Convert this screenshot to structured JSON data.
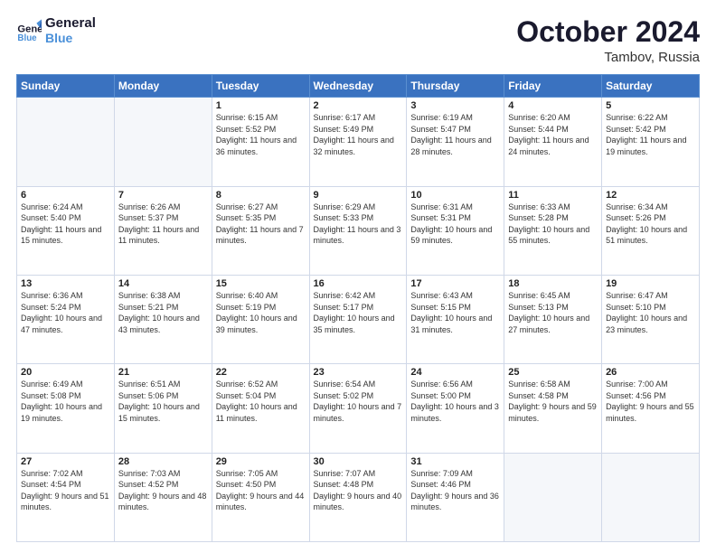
{
  "header": {
    "logo_line1": "General",
    "logo_line2": "Blue",
    "month": "October 2024",
    "location": "Tambov, Russia"
  },
  "weekdays": [
    "Sunday",
    "Monday",
    "Tuesday",
    "Wednesday",
    "Thursday",
    "Friday",
    "Saturday"
  ],
  "weeks": [
    [
      {
        "num": "",
        "info": ""
      },
      {
        "num": "",
        "info": ""
      },
      {
        "num": "1",
        "info": "Sunrise: 6:15 AM\nSunset: 5:52 PM\nDaylight: 11 hours and 36 minutes."
      },
      {
        "num": "2",
        "info": "Sunrise: 6:17 AM\nSunset: 5:49 PM\nDaylight: 11 hours and 32 minutes."
      },
      {
        "num": "3",
        "info": "Sunrise: 6:19 AM\nSunset: 5:47 PM\nDaylight: 11 hours and 28 minutes."
      },
      {
        "num": "4",
        "info": "Sunrise: 6:20 AM\nSunset: 5:44 PM\nDaylight: 11 hours and 24 minutes."
      },
      {
        "num": "5",
        "info": "Sunrise: 6:22 AM\nSunset: 5:42 PM\nDaylight: 11 hours and 19 minutes."
      }
    ],
    [
      {
        "num": "6",
        "info": "Sunrise: 6:24 AM\nSunset: 5:40 PM\nDaylight: 11 hours and 15 minutes."
      },
      {
        "num": "7",
        "info": "Sunrise: 6:26 AM\nSunset: 5:37 PM\nDaylight: 11 hours and 11 minutes."
      },
      {
        "num": "8",
        "info": "Sunrise: 6:27 AM\nSunset: 5:35 PM\nDaylight: 11 hours and 7 minutes."
      },
      {
        "num": "9",
        "info": "Sunrise: 6:29 AM\nSunset: 5:33 PM\nDaylight: 11 hours and 3 minutes."
      },
      {
        "num": "10",
        "info": "Sunrise: 6:31 AM\nSunset: 5:31 PM\nDaylight: 10 hours and 59 minutes."
      },
      {
        "num": "11",
        "info": "Sunrise: 6:33 AM\nSunset: 5:28 PM\nDaylight: 10 hours and 55 minutes."
      },
      {
        "num": "12",
        "info": "Sunrise: 6:34 AM\nSunset: 5:26 PM\nDaylight: 10 hours and 51 minutes."
      }
    ],
    [
      {
        "num": "13",
        "info": "Sunrise: 6:36 AM\nSunset: 5:24 PM\nDaylight: 10 hours and 47 minutes."
      },
      {
        "num": "14",
        "info": "Sunrise: 6:38 AM\nSunset: 5:21 PM\nDaylight: 10 hours and 43 minutes."
      },
      {
        "num": "15",
        "info": "Sunrise: 6:40 AM\nSunset: 5:19 PM\nDaylight: 10 hours and 39 minutes."
      },
      {
        "num": "16",
        "info": "Sunrise: 6:42 AM\nSunset: 5:17 PM\nDaylight: 10 hours and 35 minutes."
      },
      {
        "num": "17",
        "info": "Sunrise: 6:43 AM\nSunset: 5:15 PM\nDaylight: 10 hours and 31 minutes."
      },
      {
        "num": "18",
        "info": "Sunrise: 6:45 AM\nSunset: 5:13 PM\nDaylight: 10 hours and 27 minutes."
      },
      {
        "num": "19",
        "info": "Sunrise: 6:47 AM\nSunset: 5:10 PM\nDaylight: 10 hours and 23 minutes."
      }
    ],
    [
      {
        "num": "20",
        "info": "Sunrise: 6:49 AM\nSunset: 5:08 PM\nDaylight: 10 hours and 19 minutes."
      },
      {
        "num": "21",
        "info": "Sunrise: 6:51 AM\nSunset: 5:06 PM\nDaylight: 10 hours and 15 minutes."
      },
      {
        "num": "22",
        "info": "Sunrise: 6:52 AM\nSunset: 5:04 PM\nDaylight: 10 hours and 11 minutes."
      },
      {
        "num": "23",
        "info": "Sunrise: 6:54 AM\nSunset: 5:02 PM\nDaylight: 10 hours and 7 minutes."
      },
      {
        "num": "24",
        "info": "Sunrise: 6:56 AM\nSunset: 5:00 PM\nDaylight: 10 hours and 3 minutes."
      },
      {
        "num": "25",
        "info": "Sunrise: 6:58 AM\nSunset: 4:58 PM\nDaylight: 9 hours and 59 minutes."
      },
      {
        "num": "26",
        "info": "Sunrise: 7:00 AM\nSunset: 4:56 PM\nDaylight: 9 hours and 55 minutes."
      }
    ],
    [
      {
        "num": "27",
        "info": "Sunrise: 7:02 AM\nSunset: 4:54 PM\nDaylight: 9 hours and 51 minutes."
      },
      {
        "num": "28",
        "info": "Sunrise: 7:03 AM\nSunset: 4:52 PM\nDaylight: 9 hours and 48 minutes."
      },
      {
        "num": "29",
        "info": "Sunrise: 7:05 AM\nSunset: 4:50 PM\nDaylight: 9 hours and 44 minutes."
      },
      {
        "num": "30",
        "info": "Sunrise: 7:07 AM\nSunset: 4:48 PM\nDaylight: 9 hours and 40 minutes."
      },
      {
        "num": "31",
        "info": "Sunrise: 7:09 AM\nSunset: 4:46 PM\nDaylight: 9 hours and 36 minutes."
      },
      {
        "num": "",
        "info": ""
      },
      {
        "num": "",
        "info": ""
      }
    ]
  ]
}
